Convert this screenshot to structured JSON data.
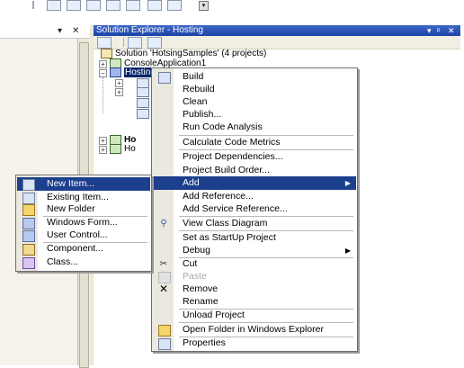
{
  "solution_explorer": {
    "title": "Solution Explorer - Hosting",
    "controls": [
      "▾",
      "ᵖ",
      "✕"
    ]
  },
  "left_panel": {
    "pin": "▾",
    "close": "✕"
  },
  "tree": {
    "solution": "Solution 'HotsingSamples' (4 projects)",
    "project1": "ConsoleApplication1",
    "selected_project": "Hosting",
    "project3": "Ho",
    "project4": "Ho"
  },
  "context_menu": {
    "items": [
      {
        "label": "Build",
        "icon": "build-icon"
      },
      {
        "label": "Rebuild"
      },
      {
        "label": "Clean"
      },
      {
        "label": "Publish..."
      },
      {
        "label": "Run Code Analysis"
      },
      {
        "label": "Calculate Code Metrics"
      },
      {
        "label": "Project Dependencies..."
      },
      {
        "label": "Project Build Order..."
      },
      {
        "label": "Add",
        "submenu": true,
        "highlighted": true
      },
      {
        "label": "Add Reference..."
      },
      {
        "label": "Add Service Reference..."
      },
      {
        "label": "View Class Diagram",
        "icon": "class-diagram-icon"
      },
      {
        "label": "Set as StartUp Project"
      },
      {
        "label": "Debug",
        "submenu": true
      },
      {
        "label": "Cut",
        "icon": "scissors-icon"
      },
      {
        "label": "Paste",
        "icon": "paste-icon",
        "disabled": true
      },
      {
        "label": "Remove",
        "icon": "remove-x-icon"
      },
      {
        "label": "Rename"
      },
      {
        "label": "Unload Project"
      },
      {
        "label": "Open Folder in Windows Explorer",
        "icon": "open-folder-icon"
      },
      {
        "label": "Properties",
        "icon": "properties-icon"
      }
    ]
  },
  "add_submenu": {
    "items": [
      {
        "label": "New Item...",
        "icon": "new-item-icon",
        "highlighted": true
      },
      {
        "label": "Existing Item...",
        "icon": "existing-item-icon"
      },
      {
        "label": "New Folder",
        "icon": "folder-icon"
      },
      {
        "label": "Windows Form...",
        "icon": "windows-form-icon"
      },
      {
        "label": "User Control...",
        "icon": "user-control-icon"
      },
      {
        "label": "Component...",
        "icon": "component-icon"
      },
      {
        "label": "Class...",
        "icon": "class-icon"
      }
    ]
  },
  "colors": {
    "highlight": "#1c3f8e",
    "title_bar": "#2a52b8",
    "selection": "#0a246a"
  }
}
